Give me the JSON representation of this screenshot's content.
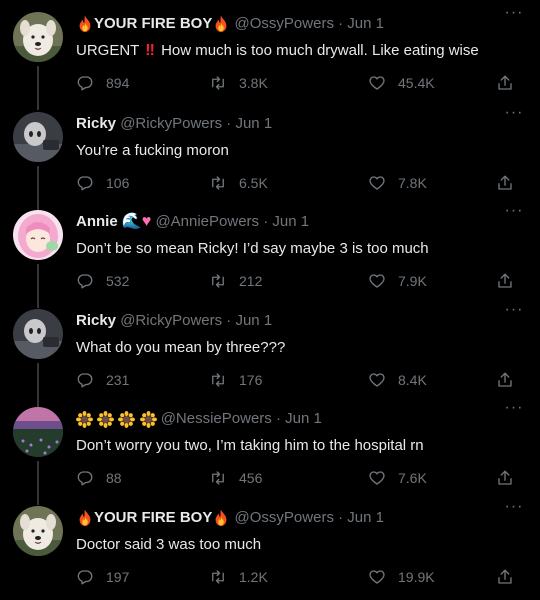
{
  "tweets": [
    {
      "name": "YOUR FIRE BOY",
      "handle": "@OssyPowers",
      "date": "Jun 1",
      "text_prefix": "URGENT",
      "text": "How much is too much drywall. Like eating wise",
      "replies": "894",
      "retweets": "3.8K",
      "likes": "45.4K",
      "avatar": "dog-avatar"
    },
    {
      "name": "Ricky",
      "handle": "@RickyPowers",
      "date": "Jun 1",
      "text": "You’re a fucking moron",
      "replies": "106",
      "retweets": "6.5K",
      "likes": "7.8K",
      "avatar": "ghost-avatar"
    },
    {
      "name": "Annie",
      "handle": "@AnniePowers",
      "date": "Jun 1",
      "text": "Don’t be so mean Ricky! I’d say maybe 3 is too much",
      "replies": "532",
      "retweets": "212",
      "likes": "7.9K",
      "avatar": "anime-avatar"
    },
    {
      "name": "Ricky",
      "handle": "@RickyPowers",
      "date": "Jun 1",
      "text": "What do you mean by three???",
      "replies": "231",
      "retweets": "176",
      "likes": "8.4K",
      "avatar": "ghost-avatar"
    },
    {
      "name": "",
      "handle": "@NessiePowers",
      "date": "Jun 1",
      "text": "Don’t worry you two, I’m taking him to the hospital rn",
      "replies": "88",
      "retweets": "456",
      "likes": "7.6K",
      "avatar": "landscape-avatar"
    },
    {
      "name": "YOUR FIRE BOY",
      "handle": "@OssyPowers",
      "date": "Jun 1",
      "text": "Doctor said 3 was too much",
      "replies": "197",
      "retweets": "1.2K",
      "likes": "19.9K",
      "avatar": "dog-avatar"
    }
  ],
  "separator": "·",
  "colors": {
    "background": "#000000",
    "text": "#e7e9ea",
    "muted": "#71767b",
    "thread_line": "#333639"
  }
}
